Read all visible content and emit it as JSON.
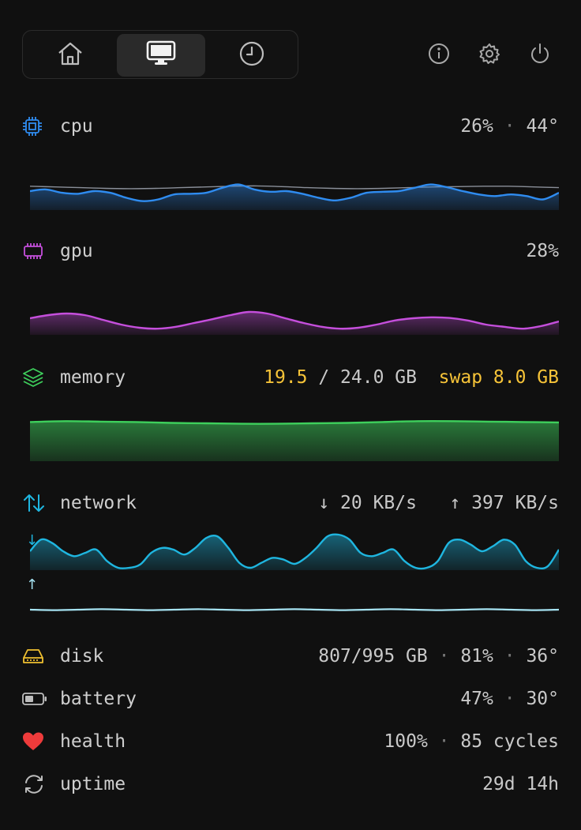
{
  "tabs": [
    {
      "name": "home",
      "icon": "home-icon",
      "active": false
    },
    {
      "name": "monitor",
      "icon": "monitor-icon",
      "active": true
    },
    {
      "name": "history",
      "icon": "clock-icon",
      "active": false
    }
  ],
  "toolbar_actions": [
    "info-icon",
    "gear-icon",
    "power-icon"
  ],
  "cpu": {
    "label": "cpu",
    "usage": "26%",
    "sep": "·",
    "temp": "44°",
    "color": "#2f8cf0"
  },
  "gpu": {
    "label": "gpu",
    "usage": "28%",
    "color": "#c54fdc"
  },
  "memory": {
    "label": "memory",
    "used": "19.5",
    "total_text": " / 24.0 GB",
    "swap": "swap 8.0 GB",
    "color": "#3ecf5c"
  },
  "network": {
    "label": "network",
    "down": "↓ 20 KB/s",
    "up": "↑ 397 KB/s",
    "down_mark": "↓",
    "up_mark": "↑",
    "color": "#1fb6e0",
    "up_color": "#a6e3f2"
  },
  "disk": {
    "label": "disk",
    "used": "807/995 GB",
    "sep1": "·",
    "pct": "81%",
    "sep2": "·",
    "temp": "36°"
  },
  "battery": {
    "label": "battery",
    "pct": "47%",
    "sep": "·",
    "temp": "30°"
  },
  "health": {
    "label": "health",
    "pct": "100%",
    "sep": "·",
    "cycles": "85 cycles"
  },
  "uptime": {
    "label": "uptime",
    "value": "29d 14h"
  },
  "series": {
    "cpu": [
      0.5,
      0.55,
      0.45,
      0.42,
      0.5,
      0.45,
      0.3,
      0.2,
      0.25,
      0.4,
      0.42,
      0.45,
      0.6,
      0.7,
      0.55,
      0.48,
      0.5,
      0.42,
      0.3,
      0.22,
      0.3,
      0.45,
      0.48,
      0.5,
      0.6,
      0.7,
      0.62,
      0.5,
      0.4,
      0.35,
      0.4,
      0.35,
      0.25,
      0.45
    ],
    "cpu_avg": [
      0.64,
      0.62,
      0.6,
      0.58,
      0.57,
      0.58,
      0.6,
      0.62,
      0.64,
      0.65,
      0.63,
      0.6,
      0.58,
      0.57,
      0.58,
      0.6,
      0.62,
      0.63,
      0.64,
      0.64,
      0.62,
      0.6
    ],
    "gpu": [
      0.45,
      0.55,
      0.6,
      0.55,
      0.4,
      0.25,
      0.15,
      0.12,
      0.18,
      0.3,
      0.42,
      0.55,
      0.65,
      0.6,
      0.45,
      0.3,
      0.18,
      0.12,
      0.15,
      0.25,
      0.38,
      0.45,
      0.48,
      0.46,
      0.38,
      0.25,
      0.18,
      0.12,
      0.2,
      0.35
    ],
    "memory": [
      0.9,
      0.92,
      0.91,
      0.9,
      0.88,
      0.87,
      0.86,
      0.86,
      0.87,
      0.88,
      0.9,
      0.92,
      0.92,
      0.91,
      0.9,
      0.89
    ],
    "net_down": [
      0.5,
      0.85,
      0.75,
      0.5,
      0.35,
      0.45,
      0.55,
      0.2,
      0.0,
      0.0,
      0.1,
      0.45,
      0.6,
      0.55,
      0.4,
      0.6,
      0.9,
      0.95,
      0.6,
      0.15,
      0.0,
      0.15,
      0.3,
      0.25,
      0.12,
      0.3,
      0.6,
      0.95,
      1.0,
      0.85,
      0.45,
      0.35,
      0.45,
      0.55,
      0.2,
      0.0,
      0.0,
      0.2,
      0.75,
      0.85,
      0.7,
      0.5,
      0.65,
      0.85,
      0.7,
      0.2,
      0.0,
      0.05,
      0.55
    ],
    "net_up": [
      0.5,
      0.45,
      0.5,
      0.55,
      0.5,
      0.45,
      0.5,
      0.55,
      0.5,
      0.45,
      0.5,
      0.55,
      0.5,
      0.45,
      0.5,
      0.55,
      0.5,
      0.45,
      0.5,
      0.55,
      0.5,
      0.45,
      0.5
    ]
  }
}
